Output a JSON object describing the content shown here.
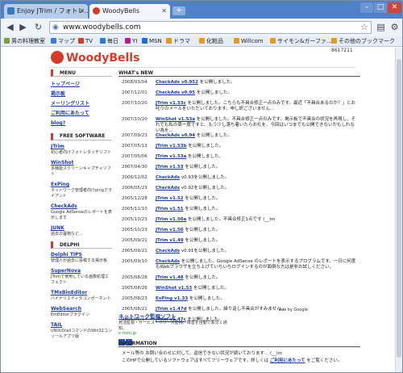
{
  "browser": {
    "tabs": [
      {
        "label": "Enjoy JTrim / フォトレ..."
      },
      {
        "label": "WoodyBells"
      }
    ],
    "url": "www.woodybells.com",
    "bookmarks": [
      "男の料理教室",
      "マップ",
      "TV",
      "毎日",
      "YI",
      "MSN",
      "ドラマ",
      "化粧品",
      "Willcom",
      "サイモン&ガーファ...",
      "その他のブックマーク"
    ]
  },
  "site": {
    "logo": "WoodyBells",
    "counter": "8617211"
  },
  "sidebar": {
    "menu_title": "MENU",
    "menu_links": [
      "トップページ",
      "掲示板",
      "メーリングリスト",
      "ご利用にあたって",
      "blog?"
    ],
    "free_title": "FREE SOFTWARE",
    "free_items": [
      {
        "title": "JTrim",
        "desc": "初心者向けフォトレタッチソフト"
      },
      {
        "title": "WinShot",
        "desc": "多機能スクリーンキャプチャソフト"
      },
      {
        "title": "ExPing",
        "desc": "ネットワーク管理者向けpingクライアント"
      },
      {
        "title": "CheckAds",
        "desc": "Google AdSenseのレポートを表示します"
      },
      {
        "title": "JUNK",
        "desc": "過去の遺物など..."
      }
    ],
    "delphi_title": "DELPHI",
    "delphi_items": [
      {
        "title": "Delphi TIPS",
        "desc": "管理人が過去に投稿する掲示板"
      },
      {
        "title": "SuperNova",
        "desc": "JTrimで使用している画像処理エフェクト"
      },
      {
        "title": "TMxBinEditor",
        "desc": "バイナリエディタコンポーネント"
      },
      {
        "title": "WebSearch",
        "desc": "EmEditorプラグイン"
      },
      {
        "title": "TAIL",
        "desc": "UNIXのtailコマンドのWin32コンソールアプリ版"
      }
    ]
  },
  "main": {
    "news_title": "WHAT's NEW",
    "news": [
      {
        "date": "2008/03/04",
        "link": "CheckAds v0.952",
        "text": " を公開しました。"
      },
      {
        "date": "2007/12/01",
        "link": "CheckAds v0.95",
        "text": " を公開しました。"
      },
      {
        "date": "2007/10/20",
        "link": "JTrim v1.53c",
        "text": " を公開しました。こちらも不具合修正ー点のみです。最近「不具合あるのか？」とお叱りのメールをいただいております。申し訳ございません..."
      },
      {
        "date": "2007/10/20",
        "link": "WinShot v1.53a",
        "text": " を公開しました。不具合修正ー点のみです。掲示板で不具合の状況を再現し、それでも私の周ー度ですと、もう少し落ち着いたらお礼を、今回はいつまでも公開できないかもしれない為を..."
      },
      {
        "date": "2007/09/23",
        "link": "CheckAds v0.94",
        "text": " を公開しました。"
      },
      {
        "date": "2007/05/13",
        "link": "JTrim v1.53b",
        "text": " を公開しました。"
      },
      {
        "date": "2007/05/06",
        "link": "JTrim v1.53a",
        "text": " を公開しました。"
      },
      {
        "date": "2007/04/30",
        "link": "JTrim v1.53",
        "text": " を公開しました。"
      },
      {
        "date": "2006/12/02",
        "date2": "",
        "link": "CheckAds",
        "text": " v0.93を公開しました。"
      },
      {
        "date": "2006/05/23",
        "link": "CheckAds",
        "text": " v0.92を公開しました。"
      },
      {
        "date": "2005/12/28",
        "link": "JTrim v1.52",
        "text": " を公開しました。"
      },
      {
        "date": "2005/11/10",
        "link": "JTrim v1.51",
        "text": " を公開しました。"
      },
      {
        "date": "2005/10/23",
        "link": "JTrim v1.50a",
        "text": " を公開しました。不具合修正1点です (__)m"
      },
      {
        "date": "2005/10/23",
        "link": "JTrim v1.50",
        "text": " を公開しました。"
      },
      {
        "date": "2005/09/21",
        "link": "JTrim v1.49",
        "text": " を公開しました。"
      },
      {
        "date": "2005/09/21",
        "link": "CheckAds",
        "text": " v0.91を公開しました。"
      },
      {
        "date": "2005/09/10",
        "link": "CheckAds",
        "text": " を公開しました。Google AdSense のレポートを表示するプログラムです。一日に何度もWebブラウザを立ち上げていちいちログインするのが面倒な方は是非お試しください。"
      },
      {
        "date": "2005/08/28",
        "link": "JTrim v1.48",
        "text": " を公開しました。"
      },
      {
        "date": "2005/08/26",
        "link": "WinShot v1.53",
        "text": " を公開しました。"
      },
      {
        "date": "2005/08/23",
        "link": "ExPing v1.33",
        "text": " を公開しました。"
      },
      {
        "date": "2005/08/21",
        "link": "JTrim v1.47d",
        "text": " を公開しました。繰り返し不具合がすみません..."
      },
      {
        "date": "2005/08/14",
        "link": "JTrim v1.47c",
        "text": " を公開しました。"
      }
    ],
    "tool_title": "ネットワーク監視ソフト",
    "tool_desc": "死活監視・サービス・リソース監視、障害を自動で素早く通知。",
    "tool_url": "x-mon.jp",
    "ads_label": "Ads by Google",
    "info_title": "INFORMATION",
    "info_line1": "メール等の お問い合わせに対して、返信できない状況が続いております... (__)m",
    "info_line2a": "このHPで公開しているソフトウェアはすべてフリーウェアです。詳しくは ",
    "info_link": "ご利用にあたって",
    "info_line2b": " をご覧ください。"
  }
}
